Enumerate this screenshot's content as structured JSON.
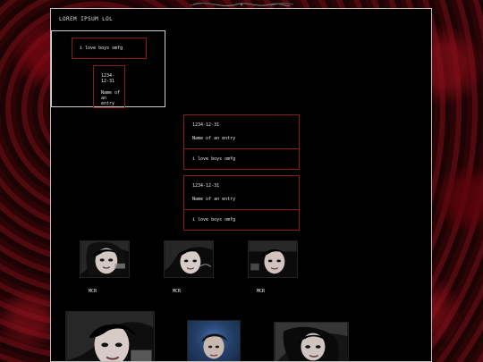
{
  "site": {
    "title": "LOREM IPSUM LOL"
  },
  "top_box": {
    "cards": [
      {
        "text": "i love boys omfg"
      },
      {
        "date": "1234-12-31",
        "name": "Name of an entry"
      }
    ]
  },
  "entries": [
    {
      "date": "1234-12-31",
      "name": "Name of an entry",
      "body": "i love boys omfg"
    },
    {
      "date": "1234-12-31",
      "name": "Name of an entry",
      "body": "i love boys omfg"
    }
  ],
  "gallery": {
    "items": [
      {
        "caption": "MCR"
      },
      {
        "caption": "MCR"
      },
      {
        "caption": "MCR"
      }
    ]
  },
  "colors": {
    "panel_bg": "#000000",
    "panel_border": "#bdbdbd",
    "accent_red": "#8b1a1a",
    "text": "#e6e6e6"
  }
}
